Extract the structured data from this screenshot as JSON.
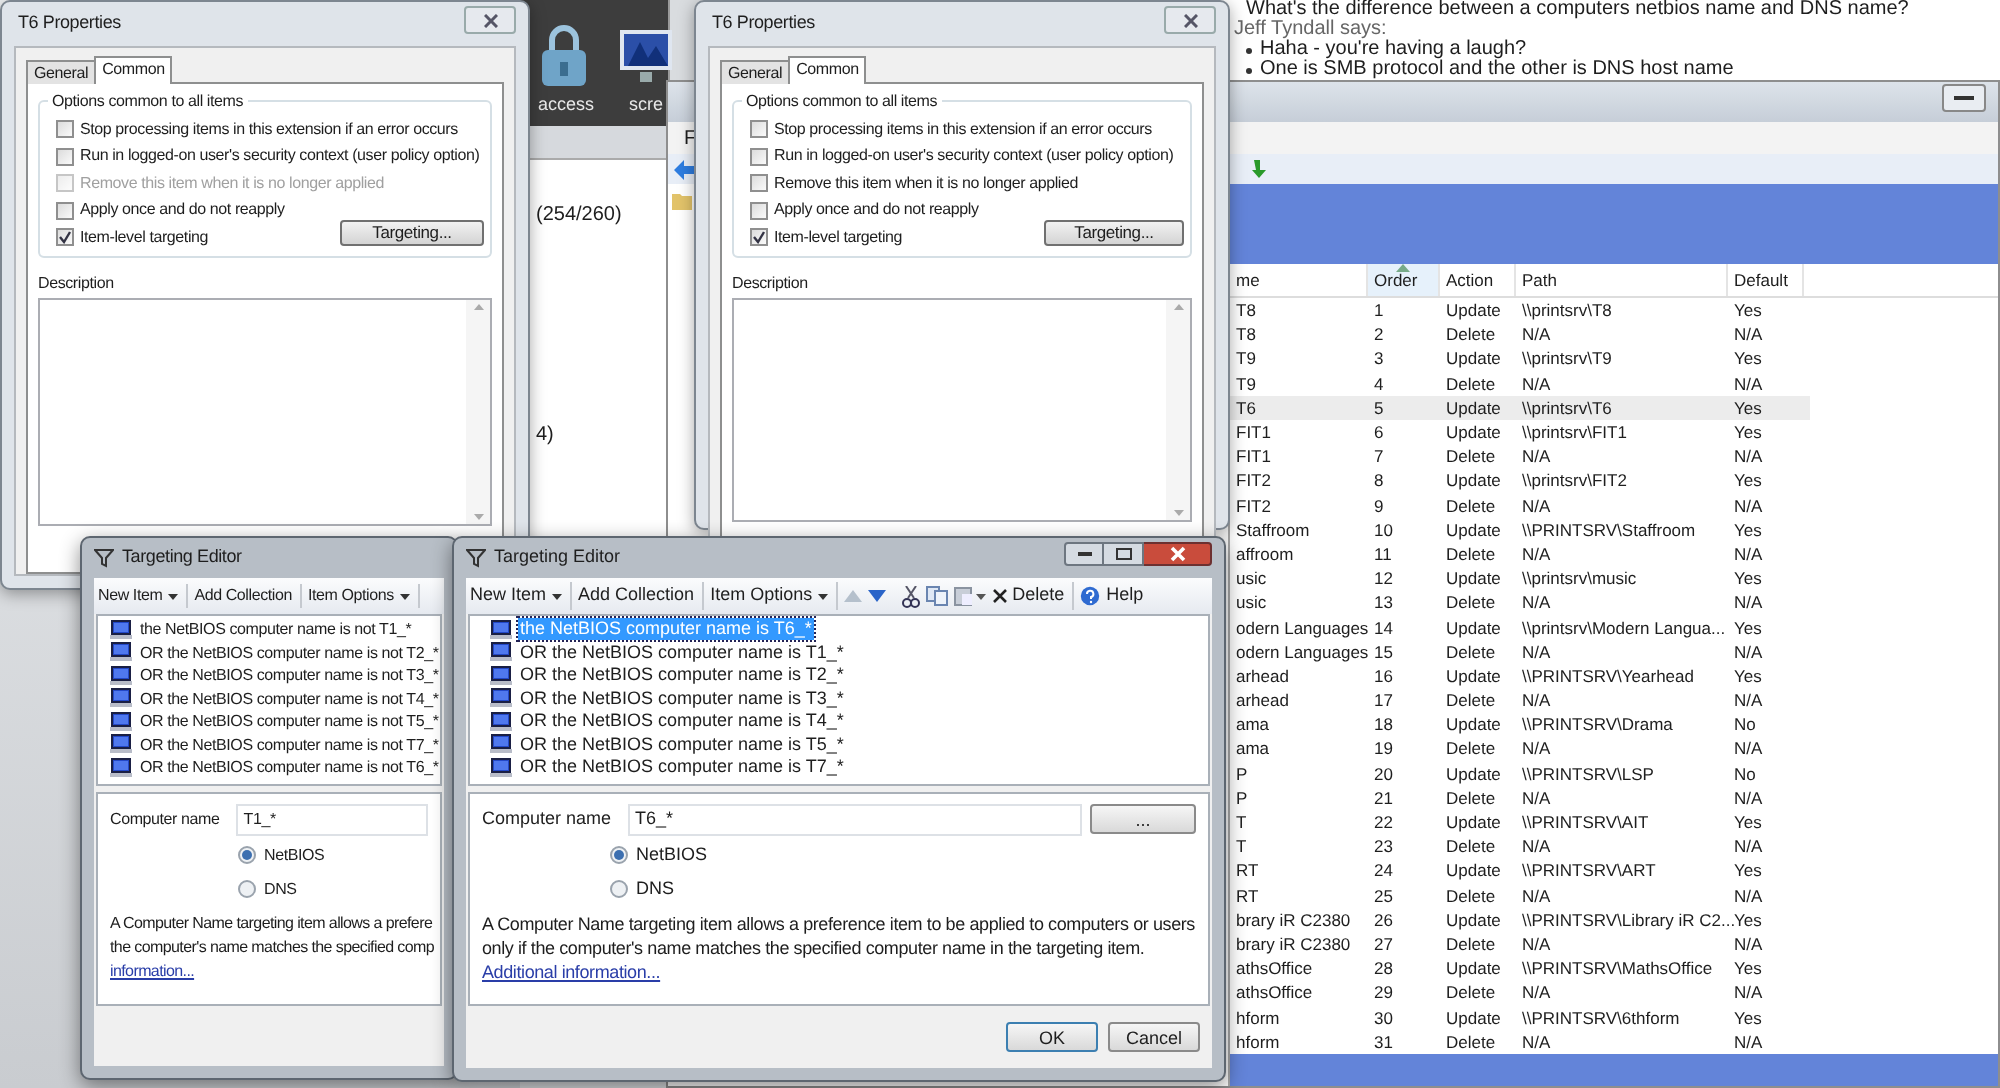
{
  "background_app": {
    "toolbar_items": [
      {
        "label": "access",
        "kind": "padlock"
      },
      {
        "label": "scre",
        "kind": "screen"
      }
    ],
    "content_lines": [
      "(254/260)",
      "4)"
    ]
  },
  "chat": {
    "lines": [
      {
        "kind": "message",
        "text": "What's the difference between a computers netbios name and DNS name?"
      },
      {
        "kind": "sender",
        "text": "Jeff Tyndall says:"
      },
      {
        "kind": "bullet",
        "text": "Haha - you're having a laugh?"
      },
      {
        "kind": "bullet",
        "text": "One is SMB protocol and the other is DNS host name"
      }
    ]
  },
  "console": {
    "menu": "F",
    "table": {
      "columns": [
        {
          "label": "me",
          "sorted": false
        },
        {
          "label": "Order",
          "sorted": true
        },
        {
          "label": "Action",
          "sorted": false
        },
        {
          "label": "Path",
          "sorted": false
        },
        {
          "label": "Default",
          "sorted": false
        }
      ],
      "rows": [
        {
          "cells": [
            "T8",
            "1",
            "Update",
            "\\\\printsrv\\T8",
            "Yes"
          ],
          "selected": false
        },
        {
          "cells": [
            "T8",
            "2",
            "Delete",
            "N/A",
            "N/A"
          ],
          "selected": false
        },
        {
          "cells": [
            "T9",
            "3",
            "Update",
            "\\\\printsrv\\T9",
            "Yes"
          ],
          "selected": false
        },
        {
          "cells": [
            "T9",
            "4",
            "Delete",
            "N/A",
            "N/A"
          ],
          "selected": false
        },
        {
          "cells": [
            "T6",
            "5",
            "Update",
            "\\\\printsrv\\T6",
            "Yes"
          ],
          "selected": true
        },
        {
          "cells": [
            "FIT1",
            "6",
            "Update",
            "\\\\printsrv\\FIT1",
            "Yes"
          ],
          "selected": false
        },
        {
          "cells": [
            "FIT1",
            "7",
            "Delete",
            "N/A",
            "N/A"
          ],
          "selected": false
        },
        {
          "cells": [
            "FIT2",
            "8",
            "Update",
            "\\\\printsrv\\FIT2",
            "Yes"
          ],
          "selected": false
        },
        {
          "cells": [
            "FIT2",
            "9",
            "Delete",
            "N/A",
            "N/A"
          ],
          "selected": false
        },
        {
          "cells": [
            "Staffroom",
            "10",
            "Update",
            "\\\\PRINTSRV\\Staffroom",
            "Yes"
          ],
          "selected": false
        },
        {
          "cells": [
            "affroom",
            "11",
            "Delete",
            "N/A",
            "N/A"
          ],
          "selected": false
        },
        {
          "cells": [
            "usic",
            "12",
            "Update",
            "\\\\printsrv\\music",
            "Yes"
          ],
          "selected": false
        },
        {
          "cells": [
            "usic",
            "13",
            "Delete",
            "N/A",
            "N/A"
          ],
          "selected": false
        },
        {
          "cells": [
            "odern Languages",
            "14",
            "Update",
            "\\\\printsrv\\Modern Langua...",
            "Yes"
          ],
          "selected": false
        },
        {
          "cells": [
            "odern Languages",
            "15",
            "Delete",
            "N/A",
            "N/A"
          ],
          "selected": false
        },
        {
          "cells": [
            "arhead",
            "16",
            "Update",
            "\\\\PRINTSRV\\Yearhead",
            "Yes"
          ],
          "selected": false
        },
        {
          "cells": [
            "arhead",
            "17",
            "Delete",
            "N/A",
            "N/A"
          ],
          "selected": false
        },
        {
          "cells": [
            "ama",
            "18",
            "Update",
            "\\\\PRINTSRV\\Drama",
            "No"
          ],
          "selected": false
        },
        {
          "cells": [
            "ama",
            "19",
            "Delete",
            "N/A",
            "N/A"
          ],
          "selected": false
        },
        {
          "cells": [
            "P",
            "20",
            "Update",
            "\\\\PRINTSRV\\LSP",
            "No"
          ],
          "selected": false
        },
        {
          "cells": [
            "P",
            "21",
            "Delete",
            "N/A",
            "N/A"
          ],
          "selected": false
        },
        {
          "cells": [
            "T",
            "22",
            "Update",
            "\\\\PRINTSRV\\AIT",
            "Yes"
          ],
          "selected": false
        },
        {
          "cells": [
            "T",
            "23",
            "Delete",
            "N/A",
            "N/A"
          ],
          "selected": false
        },
        {
          "cells": [
            "RT",
            "24",
            "Update",
            "\\\\PRINTSRV\\ART",
            "Yes"
          ],
          "selected": false
        },
        {
          "cells": [
            "RT",
            "25",
            "Delete",
            "N/A",
            "N/A"
          ],
          "selected": false
        },
        {
          "cells": [
            "brary iR C2380",
            "26",
            "Update",
            "\\\\PRINTSRV\\Library iR C2...",
            "Yes"
          ],
          "selected": false
        },
        {
          "cells": [
            "brary iR C2380",
            "27",
            "Delete",
            "N/A",
            "N/A"
          ],
          "selected": false
        },
        {
          "cells": [
            "athsOffice",
            "28",
            "Update",
            "\\\\PRINTSRV\\MathsOffice",
            "Yes"
          ],
          "selected": false
        },
        {
          "cells": [
            "athsOffice",
            "29",
            "Delete",
            "N/A",
            "N/A"
          ],
          "selected": false
        },
        {
          "cells": [
            "hform",
            "30",
            "Update",
            "\\\\PRINTSRV\\6thform",
            "Yes"
          ],
          "selected": false
        },
        {
          "cells": [
            "hform",
            "31",
            "Delete",
            "N/A",
            "N/A"
          ],
          "selected": false
        }
      ]
    }
  },
  "properties_dialogs": [
    {
      "title": "T6 Properties",
      "tabs": [
        {
          "label": "General",
          "selected": false
        },
        {
          "label": "Common",
          "selected": true
        }
      ],
      "group_title": "Options common to all items",
      "options": [
        {
          "label": "Stop processing items in this extension if an error occurs",
          "checked": false,
          "disabled": false
        },
        {
          "label": "Run in logged-on user's security context (user policy option)",
          "checked": false,
          "disabled": false
        },
        {
          "label": "Remove this item when it is no longer applied",
          "checked": false,
          "disabled": true
        },
        {
          "label": "Apply once and do not reapply",
          "checked": false,
          "disabled": false
        },
        {
          "label": "Item-level targeting",
          "checked": true,
          "disabled": false
        }
      ],
      "targeting_button": "Targeting...",
      "description_label": "Description"
    },
    {
      "title": "T6 Properties",
      "tabs": [
        {
          "label": "General",
          "selected": false
        },
        {
          "label": "Common",
          "selected": true
        }
      ],
      "group_title": "Options common to all items",
      "options": [
        {
          "label": "Stop processing items in this extension if an error occurs",
          "checked": false,
          "disabled": false
        },
        {
          "label": "Run in logged-on user's security context (user policy option)",
          "checked": false,
          "disabled": false
        },
        {
          "label": "Remove this item when it is no longer applied",
          "checked": false,
          "disabled": false
        },
        {
          "label": "Apply once and do not reapply",
          "checked": false,
          "disabled": false
        },
        {
          "label": "Item-level targeting",
          "checked": true,
          "disabled": false
        }
      ],
      "targeting_button": "Targeting...",
      "description_label": "Description"
    }
  ],
  "targeting_editors": [
    {
      "title": "Targeting Editor",
      "toolbar": [
        {
          "kind": "menu",
          "label": "New Item"
        },
        {
          "kind": "text",
          "label": "Add Collection"
        },
        {
          "kind": "menu",
          "label": "Item Options"
        }
      ],
      "items": [
        {
          "text": "the NetBIOS computer name is not T1_*",
          "selected": false
        },
        {
          "text": "OR the NetBIOS computer name is not T2_*",
          "selected": false
        },
        {
          "text": "OR the NetBIOS computer name is not T3_*",
          "selected": false
        },
        {
          "text": "OR the NetBIOS computer name is not T4_*",
          "selected": false
        },
        {
          "text": "OR the NetBIOS computer name is not T5_*",
          "selected": false
        },
        {
          "text": "OR the NetBIOS computer name is not T7_*",
          "selected": false
        },
        {
          "text": "OR the NetBIOS computer name is not T6_*",
          "selected": false
        }
      ],
      "field_label": "Computer name",
      "field_value": "T1_*",
      "radios": [
        {
          "label": "NetBIOS",
          "selected": true
        },
        {
          "label": "DNS",
          "selected": false
        }
      ],
      "description_lines": [
        "A Computer Name targeting item allows a prefere",
        "the computer's name matches the specified comp"
      ],
      "link": "information..."
    },
    {
      "title": "Targeting Editor",
      "toolbar": [
        {
          "kind": "menu",
          "label": "New Item"
        },
        {
          "kind": "text",
          "label": "Add Collection"
        },
        {
          "kind": "menu",
          "label": "Item Options"
        },
        {
          "kind": "up"
        },
        {
          "kind": "down"
        },
        {
          "kind": "cut"
        },
        {
          "kind": "copy"
        },
        {
          "kind": "paste"
        },
        {
          "kind": "delete",
          "label": "Delete"
        },
        {
          "kind": "help",
          "label": "Help"
        }
      ],
      "items": [
        {
          "text": "the NetBIOS computer name is T6_*",
          "selected": true
        },
        {
          "text": "OR the NetBIOS computer name is T1_*",
          "selected": false
        },
        {
          "text": "OR the NetBIOS computer name is T2_*",
          "selected": false
        },
        {
          "text": "OR the NetBIOS computer name is T3_*",
          "selected": false
        },
        {
          "text": "OR the NetBIOS computer name is T4_*",
          "selected": false
        },
        {
          "text": "OR the NetBIOS computer name is T5_*",
          "selected": false
        },
        {
          "text": "OR the NetBIOS computer name is T7_*",
          "selected": false
        }
      ],
      "field_label": "Computer name",
      "field_value": "T6_*",
      "browse_button": "...",
      "radios": [
        {
          "label": "NetBIOS",
          "selected": true
        },
        {
          "label": "DNS",
          "selected": false
        }
      ],
      "description": "A Computer Name targeting item allows a preference item to be applied to computers or users only if the computer's name matches the specified computer name in the targeting item.",
      "link": "Additional information...",
      "buttons": [
        "OK",
        "Cancel"
      ]
    }
  ]
}
